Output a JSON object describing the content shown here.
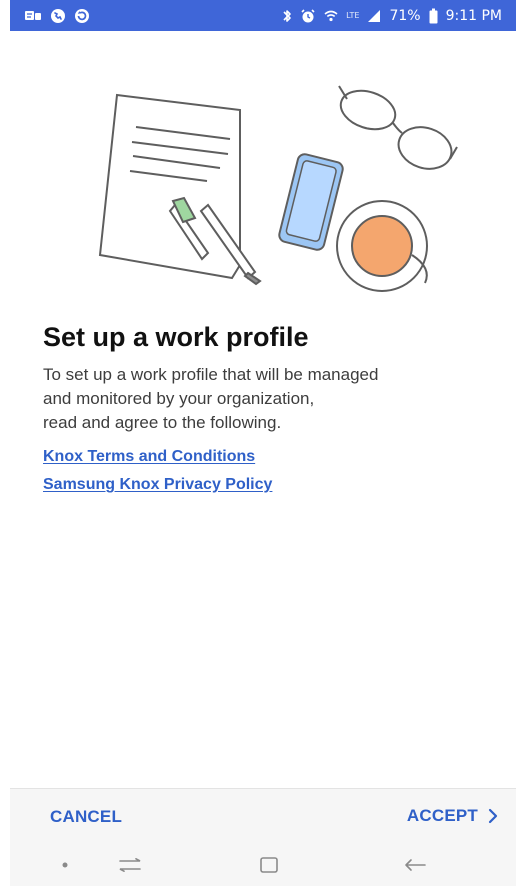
{
  "status_bar": {
    "icons_left": [
      "messages-icon",
      "phone-icon",
      "refresh-icon"
    ],
    "icons_right": [
      "bluetooth-icon",
      "alarm-icon",
      "wifi-icon",
      "lte-icon",
      "signal-icon",
      "battery-icon"
    ],
    "lte_text": "LTE",
    "battery_text": "71%",
    "time_text": "9:11 PM",
    "background_color": "#3f66d8"
  },
  "illustration": {
    "items": [
      "document-icon",
      "glasses-icon",
      "pen-icon",
      "phone-icon",
      "coffee-cup-icon"
    ],
    "accent_colors": {
      "phone": "#9cc6f4",
      "coffee": "#f4a66e",
      "pen_cap": "#9fd7a0"
    }
  },
  "content": {
    "title": "Set up a work profile",
    "description": "To set up a work profile that will be managed\nand monitored by your organization,\nread and agree to the following.",
    "links": [
      {
        "label": "Knox Terms and Conditions"
      },
      {
        "label": "Samsung Knox Privacy Policy"
      }
    ]
  },
  "actions": {
    "cancel_label": "CANCEL",
    "accept_label": "ACCEPT",
    "accent_color": "#2f60c8"
  },
  "navigation": {
    "items": [
      "dot-icon",
      "recent-apps-icon",
      "home-icon",
      "back-icon"
    ]
  }
}
